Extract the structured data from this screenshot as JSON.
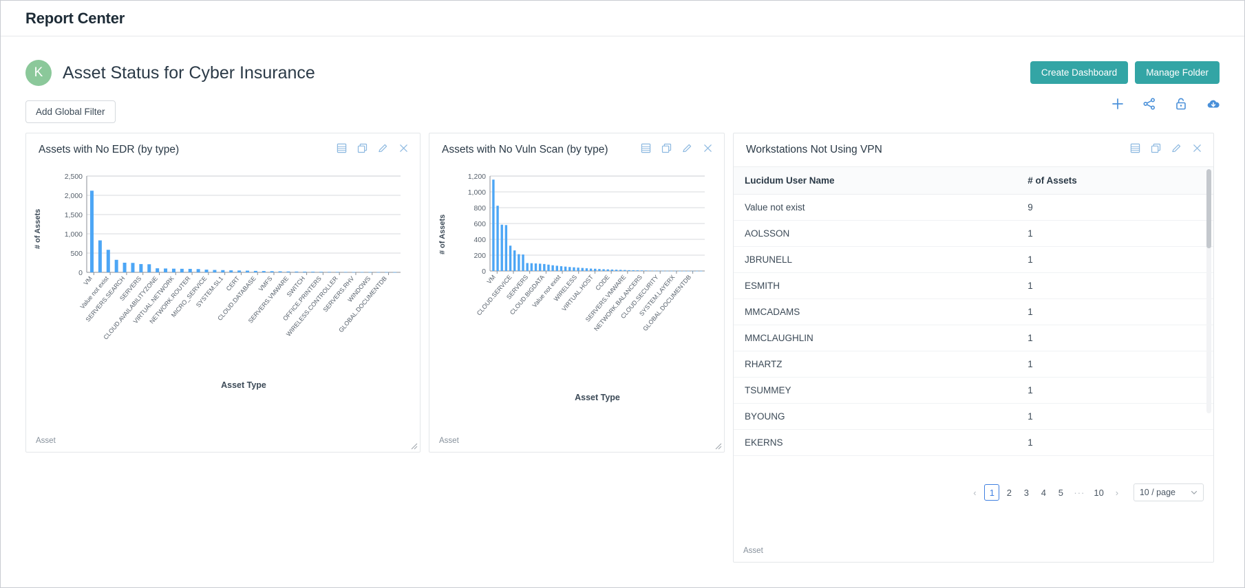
{
  "topbar": {
    "title": "Report Center"
  },
  "folder": {
    "avatar_initial": "K",
    "title": "Asset Status for Cyber Insurance",
    "create_dashboard_label": "Create Dashboard",
    "manage_folder_label": "Manage Folder"
  },
  "filters": {
    "add_global_filter_label": "Add Global Filter"
  },
  "toolbar_icons": [
    "plus-icon",
    "share-icon",
    "unlock-icon",
    "download-cloud-icon"
  ],
  "colors": {
    "accent_teal": "#33a5a5",
    "bar_blue": "#4da6f5",
    "icon_blue": "#4a90d9",
    "avatar_green": "#8bc89a",
    "active_page_blue": "#3f7fe0"
  },
  "card_icons": [
    "list-icon",
    "copy-icon",
    "pencil-icon",
    "close-icon"
  ],
  "cards": [
    {
      "title": "Assets with No EDR (by type)",
      "footer": "Asset"
    },
    {
      "title": "Assets with No Vuln Scan (by type)",
      "footer": "Asset"
    },
    {
      "title": "Workstations Not Using VPN",
      "footer": "Asset"
    }
  ],
  "chart_data": [
    {
      "type": "bar",
      "title": "Assets with No EDR (by type)",
      "xlabel": "Asset Type",
      "ylabel": "# of Assets",
      "ylim": [
        0,
        2500
      ],
      "yticks": [
        0,
        500,
        1000,
        1500,
        2000,
        2500
      ],
      "ytick_labels": [
        "0",
        "500",
        "1,000",
        "1,500",
        "2,000",
        "2,500"
      ],
      "grid": true,
      "legend": "none",
      "categories": [
        "VM",
        "",
        "Value not exist",
        "",
        "SERVERS.SEARCH",
        "",
        "SERVERS",
        "",
        "CLOUD.AVAILABILITYZONE",
        "",
        "VIRTUAL.NETWORK",
        "",
        "NETWORK.ROUTER",
        "",
        "MICRO_SERVICE",
        "",
        "SYSTEM.SL1",
        "",
        "CERT",
        "",
        "CLOUD.DATABASE",
        "",
        "VMFS",
        "",
        "SERVERS.VMWARE",
        "",
        "SWITCH",
        "",
        "OFFICE.PRINTERS",
        "",
        "WIRELESS.CONTROLLER",
        "",
        "SERVERS.RHV",
        "",
        "WINDOWS",
        "",
        "GLOBAL.DOCUMENTDB",
        ""
      ],
      "tick_labels": [
        "VM",
        "Value not exist",
        "SERVERS.SEARCH",
        "SERVERS",
        "CLOUD.AVAILABILITYZONE",
        "VIRTUAL.NETWORK",
        "NETWORK.ROUTER",
        "MICRO_SERVICE",
        "SYSTEM.SL1",
        "CERT",
        "CLOUD.DATABASE",
        "VMFS",
        "SERVERS.VMWARE",
        "SWITCH",
        "OFFICE.PRINTERS",
        "WIRELESS.CONTROLLER",
        "SERVERS.RHV",
        "WINDOWS",
        "GLOBAL.DOCUMENTDB"
      ],
      "values": [
        2120,
        830,
        585,
        325,
        250,
        245,
        215,
        210,
        105,
        100,
        95,
        92,
        90,
        85,
        70,
        62,
        58,
        52,
        48,
        44,
        38,
        34,
        30,
        26,
        22,
        20,
        18,
        16,
        14,
        12,
        11,
        10,
        9,
        8,
        7,
        6,
        5,
        4
      ]
    },
    {
      "type": "bar",
      "title": "Assets with No Vuln Scan (by type)",
      "xlabel": "Asset Type",
      "ylabel": "# of Assets",
      "ylim": [
        0,
        1200
      ],
      "yticks": [
        0,
        200,
        400,
        600,
        800,
        1000,
        1200
      ],
      "ytick_labels": [
        "0",
        "200",
        "400",
        "600",
        "800",
        "1,000",
        "1,200"
      ],
      "grid": true,
      "legend": "none",
      "tick_labels": [
        "VM",
        "CLOUD.SERVICE",
        "SERVERS",
        "CLOUD.BIGDATA",
        "Value not exist",
        "WIRELESS",
        "VIRTUAL.HOST",
        "CODE",
        "SERVERS.VMWARE",
        "NETWORK.BALANCERS",
        "CLOUD.SECURITY",
        "SYSTEM.LAYERX",
        "GLOBAL.DOCUMENTDB"
      ],
      "values": [
        1155,
        825,
        585,
        580,
        320,
        260,
        212,
        208,
        100,
        98,
        95,
        92,
        88,
        80,
        72,
        66,
        60,
        55,
        50,
        46,
        42,
        38,
        34,
        30,
        28,
        25,
        22,
        20,
        18,
        16,
        14,
        12,
        10,
        9,
        8,
        7,
        6,
        5,
        4,
        3,
        3,
        2,
        2,
        2,
        1,
        1,
        1,
        1,
        1,
        1
      ]
    }
  ],
  "table": {
    "columns": [
      "Lucidum User Name",
      "# of Assets"
    ],
    "rows": [
      [
        "Value not exist",
        "9"
      ],
      [
        "AOLSSON",
        "1"
      ],
      [
        "JBRUNELL",
        "1"
      ],
      [
        "ESMITH",
        "1"
      ],
      [
        "MMCADAMS",
        "1"
      ],
      [
        "MMCLAUGHLIN",
        "1"
      ],
      [
        "RHARTZ",
        "1"
      ],
      [
        "TSUMMEY",
        "1"
      ],
      [
        "BYOUNG",
        "1"
      ],
      [
        "EKERNS",
        "1"
      ]
    ],
    "pagination": {
      "prev": "‹",
      "next": "›",
      "pages": [
        "1",
        "2",
        "3",
        "4",
        "5"
      ],
      "dots": "···",
      "last": "10",
      "active": "1",
      "page_size": "10 / page"
    }
  }
}
